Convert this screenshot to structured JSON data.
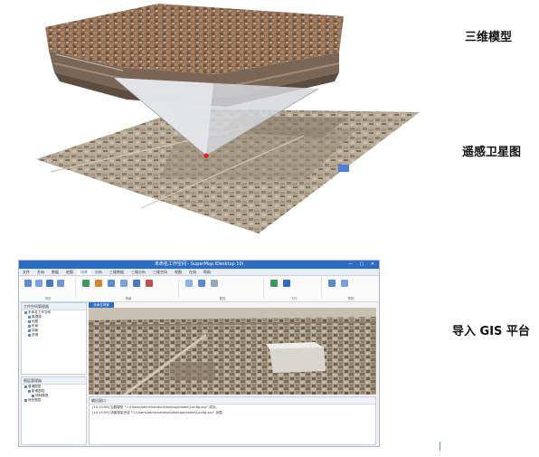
{
  "labels": {
    "model_3d": "三维模型",
    "satellite": "遥感卫星图",
    "import_gis": "导入 GIS 平台"
  },
  "gis_window": {
    "title": "未命名工作空间 - SuperMap iDesktop 10i",
    "tabs": [
      "文件",
      "开始",
      "数据",
      "地图",
      "场景",
      "分析",
      "三维数据",
      "三维分析",
      "三维空间",
      "视图",
      "在线",
      "帮助"
    ],
    "active_tab_index": 4,
    "ribbon_groups": [
      "浏览",
      "场景",
      "属性",
      "飞行",
      "帮助"
    ],
    "workspace_panel": {
      "title": "工作空间管理器",
      "tree": [
        "未命名工作空间",
        "数据源",
        "地图",
        "布局",
        "场景",
        "资源"
      ]
    },
    "layer_panel": {
      "title": "图层管理器",
      "tree": [
        "普通图层",
        "影像图层",
        "倾斜模型",
        "地形图层"
      ]
    },
    "document_tab": "未命名场景",
    "output_panel": {
      "title": "输出窗口",
      "lines": [
        "[10:15:08] 加载模型 \"C:\\Users\\Administrator\\Desktop\\model\\Config.scp\" 成功。",
        "[10:15:09] 场景渲染完成 \"C:\\Users\\Administrator\\Desktop\\model\\Config.scp\" 加载。"
      ]
    }
  },
  "colors": {
    "titlebar": "#2b6cc4",
    "accent": "#2b6cc4",
    "marker": "#e02020"
  }
}
